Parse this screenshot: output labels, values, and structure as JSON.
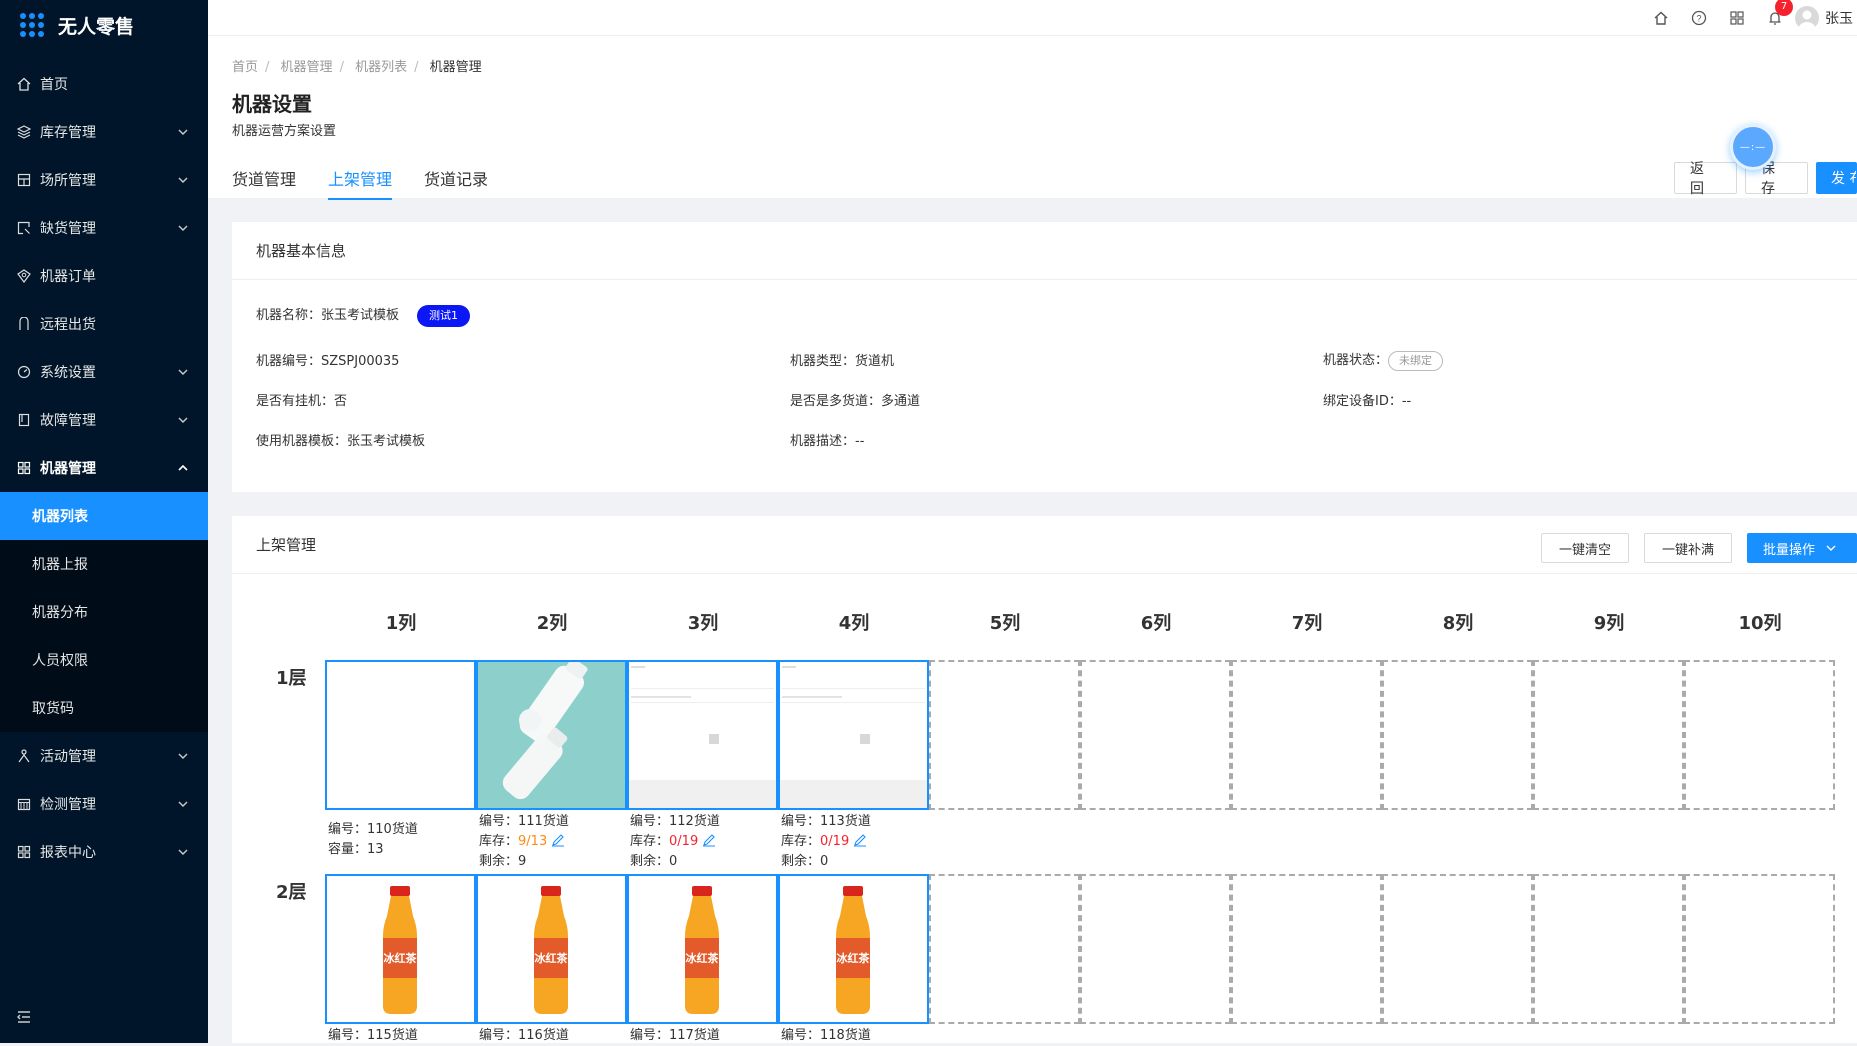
{
  "app": {
    "title": "无人零售"
  },
  "sidebar": {
    "items": [
      {
        "label": "首页"
      },
      {
        "label": "库存管理"
      },
      {
        "label": "场所管理"
      },
      {
        "label": "缺货管理"
      },
      {
        "label": "机器订单"
      },
      {
        "label": "远程出货"
      },
      {
        "label": "系统设置"
      },
      {
        "label": "故障管理"
      },
      {
        "label": "机器管理"
      }
    ],
    "submenu": [
      {
        "label": "机器列表"
      },
      {
        "label": "机器上报"
      },
      {
        "label": "机器分布"
      },
      {
        "label": "人员权限"
      },
      {
        "label": "取货码"
      }
    ],
    "items_after": [
      {
        "label": "活动管理"
      },
      {
        "label": "检测管理"
      },
      {
        "label": "报表中心"
      }
    ]
  },
  "topbar": {
    "notifications": "7",
    "username": "张玉"
  },
  "breadcrumb": [
    "首页",
    "机器管理",
    "机器列表",
    "机器管理"
  ],
  "page": {
    "title": "机器设置",
    "subtitle": "机器运营方案设置"
  },
  "tabs": [
    {
      "label": "货道管理"
    },
    {
      "label": "上架管理"
    },
    {
      "label": "货道记录"
    }
  ],
  "header_buttons": {
    "back": "返 回",
    "save": "保 存",
    "publish": "发 布"
  },
  "float_ball": {
    "text": "—:—"
  },
  "basic_info": {
    "title": "机器基本信息",
    "name_label": "机器名称：",
    "name_value": "张玉考试模板",
    "name_tag": "测试1",
    "code_label": "机器编号：",
    "code_value": "SZSPJ00035",
    "type_label": "机器类型：",
    "type_value": "货道机",
    "status_label": "机器状态：",
    "status_value": "未绑定",
    "hang_label": "是否有挂机：",
    "hang_value": "否",
    "multi_label": "是否是多货道：",
    "multi_value": "多通道",
    "device_label": "绑定设备ID：",
    "device_value": "--",
    "template_label": "使用机器模板：",
    "template_value": "张玉考试模板",
    "desc_label": "机器描述：",
    "desc_value": "--"
  },
  "shelf": {
    "title": "上架管理",
    "clear_btn": "一键清空",
    "fill_btn": "一键补满",
    "batch_btn": "批量操作",
    "columns": [
      "1列",
      "2列",
      "3列",
      "4列",
      "5列",
      "6列",
      "7列",
      "8列",
      "9列",
      "10列"
    ],
    "rows": [
      "1层",
      "2层"
    ],
    "labels": {
      "code": "编号：",
      "stock": "库存：",
      "remain": "剩余：",
      "capacity": "容量："
    },
    "row1": [
      {
        "code": "110货道",
        "capacity": "13"
      },
      {
        "code": "111货道",
        "stock": "9/13",
        "remain": "9"
      },
      {
        "code": "112货道",
        "stock": "0/19",
        "remain": "0"
      },
      {
        "code": "113货道",
        "stock": "0/19",
        "remain": "0"
      }
    ],
    "row2": [
      {
        "code": "115货道"
      },
      {
        "code": "116货道"
      },
      {
        "code": "117货道"
      },
      {
        "code": "118货道"
      }
    ]
  },
  "colors": {
    "primary": "#1890ff",
    "sidebar": "#001529",
    "tag": "#0b18f5",
    "danger": "#f5222d"
  }
}
